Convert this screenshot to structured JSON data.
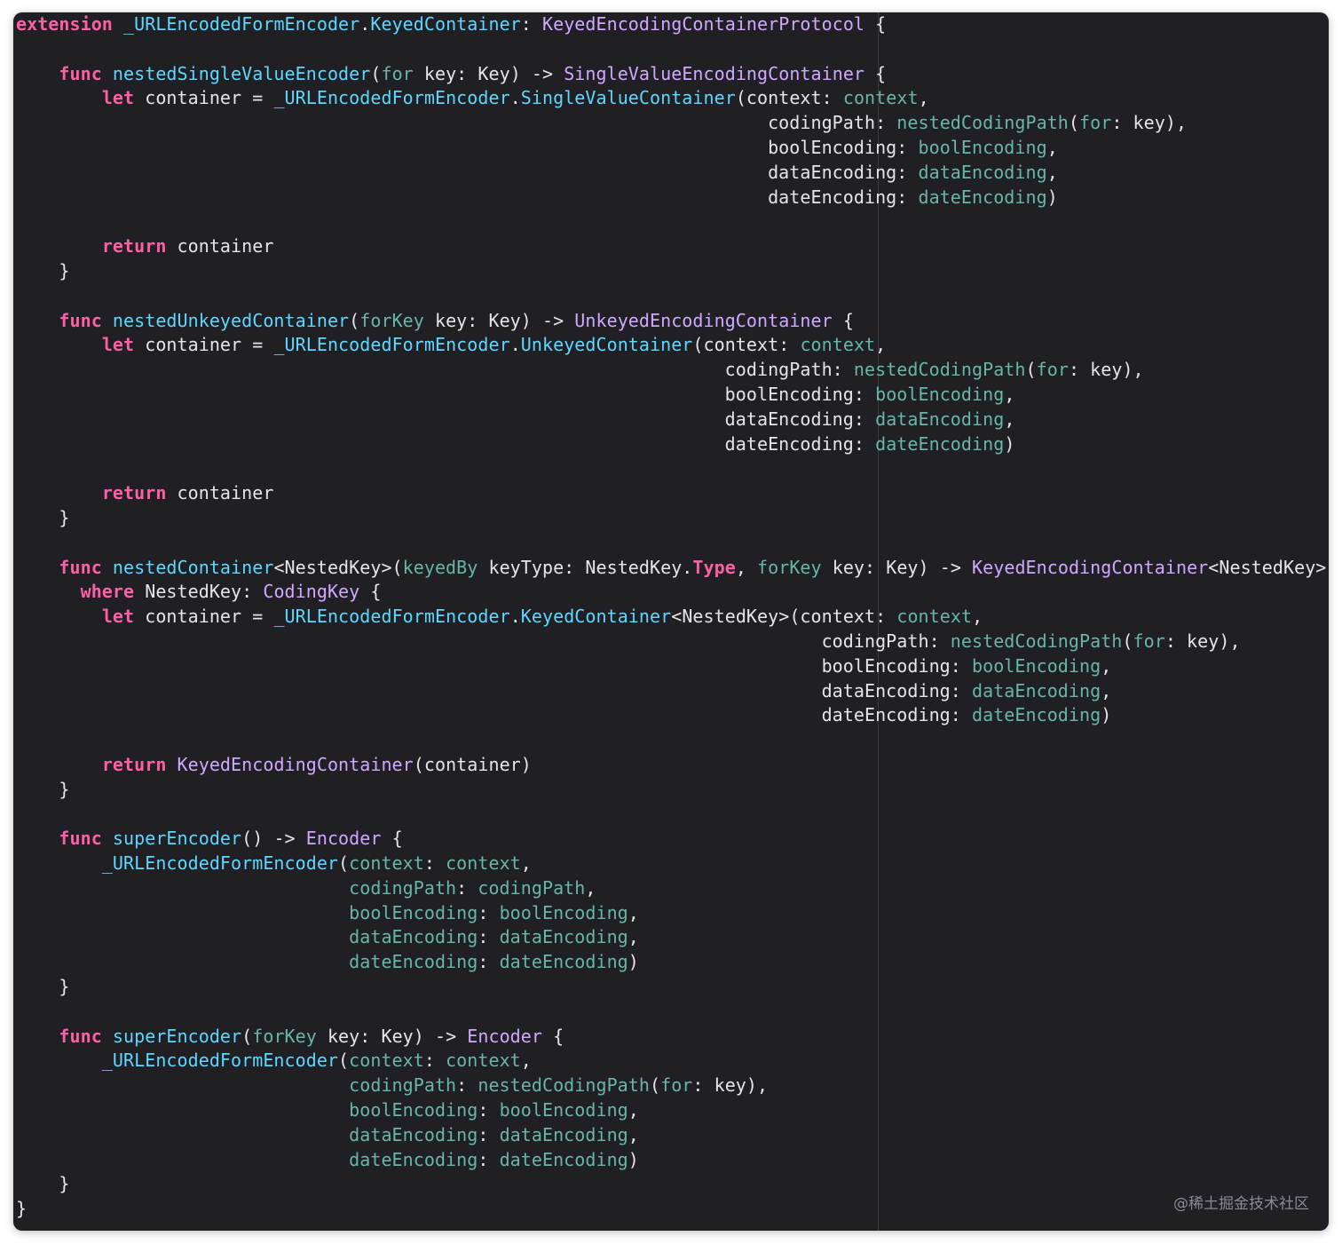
{
  "editor": {
    "theme_colors": {
      "background": "#1f1f24",
      "keyword": "#fc5fa3",
      "function_name": "#67b7a4",
      "type_name": "#d0a8ff",
      "extension_type": "#5dd8ff",
      "plain": "#e6e6e6"
    },
    "lines": [
      [
        [
          "kw",
          "extension"
        ],
        [
          "pl",
          " "
        ],
        [
          "ex",
          "_URLEncodedFormEncoder"
        ],
        [
          "pl",
          "."
        ],
        [
          "ex",
          "KeyedContainer"
        ],
        [
          "pl",
          ": "
        ],
        [
          "ty",
          "KeyedEncodingContainerProtocol"
        ],
        [
          "pl",
          " {"
        ]
      ],
      [],
      [
        [
          "pl",
          "    "
        ],
        [
          "kw",
          "func"
        ],
        [
          "pl",
          " "
        ],
        [
          "ex",
          "nestedSingleValueEncoder"
        ],
        [
          "pl",
          "("
        ],
        [
          "fn",
          "for"
        ],
        [
          "pl",
          " key: Key) -> "
        ],
        [
          "ty",
          "SingleValueEncodingContainer"
        ],
        [
          "pl",
          " {"
        ]
      ],
      [
        [
          "pl",
          "        "
        ],
        [
          "kw",
          "let"
        ],
        [
          "pl",
          " container = "
        ],
        [
          "ex",
          "_URLEncodedFormEncoder"
        ],
        [
          "pl",
          "."
        ],
        [
          "ex",
          "SingleValueContainer"
        ],
        [
          "pl",
          "(context: "
        ],
        [
          "fn",
          "context"
        ],
        [
          "pl",
          ","
        ]
      ],
      [
        [
          "pl",
          "                                                                      codingPath: "
        ],
        [
          "fn",
          "nestedCodingPath"
        ],
        [
          "pl",
          "("
        ],
        [
          "fn",
          "for"
        ],
        [
          "pl",
          ": key),"
        ]
      ],
      [
        [
          "pl",
          "                                                                      boolEncoding: "
        ],
        [
          "fn",
          "boolEncoding"
        ],
        [
          "pl",
          ","
        ]
      ],
      [
        [
          "pl",
          "                                                                      dataEncoding: "
        ],
        [
          "fn",
          "dataEncoding"
        ],
        [
          "pl",
          ","
        ]
      ],
      [
        [
          "pl",
          "                                                                      dateEncoding: "
        ],
        [
          "fn",
          "dateEncoding"
        ],
        [
          "pl",
          ")"
        ]
      ],
      [],
      [
        [
          "pl",
          "        "
        ],
        [
          "kw",
          "return"
        ],
        [
          "pl",
          " container"
        ]
      ],
      [
        [
          "pl",
          "    }"
        ]
      ],
      [],
      [
        [
          "pl",
          "    "
        ],
        [
          "kw",
          "func"
        ],
        [
          "pl",
          " "
        ],
        [
          "ex",
          "nestedUnkeyedContainer"
        ],
        [
          "pl",
          "("
        ],
        [
          "fn",
          "forKey"
        ],
        [
          "pl",
          " key: Key) -> "
        ],
        [
          "ty",
          "UnkeyedEncodingContainer"
        ],
        [
          "pl",
          " {"
        ]
      ],
      [
        [
          "pl",
          "        "
        ],
        [
          "kw",
          "let"
        ],
        [
          "pl",
          " container = "
        ],
        [
          "ex",
          "_URLEncodedFormEncoder"
        ],
        [
          "pl",
          "."
        ],
        [
          "ex",
          "UnkeyedContainer"
        ],
        [
          "pl",
          "(context: "
        ],
        [
          "fn",
          "context"
        ],
        [
          "pl",
          ","
        ]
      ],
      [
        [
          "pl",
          "                                                                  codingPath: "
        ],
        [
          "fn",
          "nestedCodingPath"
        ],
        [
          "pl",
          "("
        ],
        [
          "fn",
          "for"
        ],
        [
          "pl",
          ": key),"
        ]
      ],
      [
        [
          "pl",
          "                                                                  boolEncoding: "
        ],
        [
          "fn",
          "boolEncoding"
        ],
        [
          "pl",
          ","
        ]
      ],
      [
        [
          "pl",
          "                                                                  dataEncoding: "
        ],
        [
          "fn",
          "dataEncoding"
        ],
        [
          "pl",
          ","
        ]
      ],
      [
        [
          "pl",
          "                                                                  dateEncoding: "
        ],
        [
          "fn",
          "dateEncoding"
        ],
        [
          "pl",
          ")"
        ]
      ],
      [],
      [
        [
          "pl",
          "        "
        ],
        [
          "kw",
          "return"
        ],
        [
          "pl",
          " container"
        ]
      ],
      [
        [
          "pl",
          "    }"
        ]
      ],
      [],
      [
        [
          "pl",
          "    "
        ],
        [
          "kw",
          "func"
        ],
        [
          "pl",
          " "
        ],
        [
          "ex",
          "nestedContainer"
        ],
        [
          "pl",
          "<NestedKey>("
        ],
        [
          "fn",
          "keyedBy"
        ],
        [
          "pl",
          " keyType: NestedKey."
        ],
        [
          "kw",
          "Type"
        ],
        [
          "pl",
          ", "
        ],
        [
          "fn",
          "forKey"
        ],
        [
          "pl",
          " key: Key) -> "
        ],
        [
          "ty",
          "KeyedEncodingContainer"
        ],
        [
          "pl",
          "<NestedKey>"
        ]
      ],
      [
        [
          "pl",
          "      "
        ],
        [
          "kw",
          "where"
        ],
        [
          "pl",
          " NestedKey: "
        ],
        [
          "ty",
          "CodingKey"
        ],
        [
          "pl",
          " {"
        ]
      ],
      [
        [
          "pl",
          "        "
        ],
        [
          "kw",
          "let"
        ],
        [
          "pl",
          " container = "
        ],
        [
          "ex",
          "_URLEncodedFormEncoder"
        ],
        [
          "pl",
          "."
        ],
        [
          "ex",
          "KeyedContainer"
        ],
        [
          "pl",
          "<NestedKey>(context: "
        ],
        [
          "fn",
          "context"
        ],
        [
          "pl",
          ","
        ]
      ],
      [
        [
          "pl",
          "                                                                           codingPath: "
        ],
        [
          "fn",
          "nestedCodingPath"
        ],
        [
          "pl",
          "("
        ],
        [
          "fn",
          "for"
        ],
        [
          "pl",
          ": key),"
        ]
      ],
      [
        [
          "pl",
          "                                                                           boolEncoding: "
        ],
        [
          "fn",
          "boolEncoding"
        ],
        [
          "pl",
          ","
        ]
      ],
      [
        [
          "pl",
          "                                                                           dataEncoding: "
        ],
        [
          "fn",
          "dataEncoding"
        ],
        [
          "pl",
          ","
        ]
      ],
      [
        [
          "pl",
          "                                                                           dateEncoding: "
        ],
        [
          "fn",
          "dateEncoding"
        ],
        [
          "pl",
          ")"
        ]
      ],
      [],
      [
        [
          "pl",
          "        "
        ],
        [
          "kw",
          "return"
        ],
        [
          "pl",
          " "
        ],
        [
          "ty",
          "KeyedEncodingContainer"
        ],
        [
          "pl",
          "(container)"
        ]
      ],
      [
        [
          "pl",
          "    }"
        ]
      ],
      [],
      [
        [
          "pl",
          "    "
        ],
        [
          "kw",
          "func"
        ],
        [
          "pl",
          " "
        ],
        [
          "ex",
          "superEncoder"
        ],
        [
          "pl",
          "() -> "
        ],
        [
          "ty",
          "Encoder"
        ],
        [
          "pl",
          " {"
        ]
      ],
      [
        [
          "pl",
          "        "
        ],
        [
          "ex",
          "_URLEncodedFormEncoder"
        ],
        [
          "pl",
          "("
        ],
        [
          "fn",
          "context"
        ],
        [
          "pl",
          ": "
        ],
        [
          "fn",
          "context"
        ],
        [
          "pl",
          ","
        ]
      ],
      [
        [
          "pl",
          "                               "
        ],
        [
          "fn",
          "codingPath"
        ],
        [
          "pl",
          ": "
        ],
        [
          "fn",
          "codingPath"
        ],
        [
          "pl",
          ","
        ]
      ],
      [
        [
          "pl",
          "                               "
        ],
        [
          "fn",
          "boolEncoding"
        ],
        [
          "pl",
          ": "
        ],
        [
          "fn",
          "boolEncoding"
        ],
        [
          "pl",
          ","
        ]
      ],
      [
        [
          "pl",
          "                               "
        ],
        [
          "fn",
          "dataEncoding"
        ],
        [
          "pl",
          ": "
        ],
        [
          "fn",
          "dataEncoding"
        ],
        [
          "pl",
          ","
        ]
      ],
      [
        [
          "pl",
          "                               "
        ],
        [
          "fn",
          "dateEncoding"
        ],
        [
          "pl",
          ": "
        ],
        [
          "fn",
          "dateEncoding"
        ],
        [
          "pl",
          ")"
        ]
      ],
      [
        [
          "pl",
          "    }"
        ]
      ],
      [],
      [
        [
          "pl",
          "    "
        ],
        [
          "kw",
          "func"
        ],
        [
          "pl",
          " "
        ],
        [
          "ex",
          "superEncoder"
        ],
        [
          "pl",
          "("
        ],
        [
          "fn",
          "forKey"
        ],
        [
          "pl",
          " key: Key) -> "
        ],
        [
          "ty",
          "Encoder"
        ],
        [
          "pl",
          " {"
        ]
      ],
      [
        [
          "pl",
          "        "
        ],
        [
          "ex",
          "_URLEncodedFormEncoder"
        ],
        [
          "pl",
          "("
        ],
        [
          "fn",
          "context"
        ],
        [
          "pl",
          ": "
        ],
        [
          "fn",
          "context"
        ],
        [
          "pl",
          ","
        ]
      ],
      [
        [
          "pl",
          "                               "
        ],
        [
          "fn",
          "codingPath"
        ],
        [
          "pl",
          ": "
        ],
        [
          "fn",
          "nestedCodingPath"
        ],
        [
          "pl",
          "("
        ],
        [
          "fn",
          "for"
        ],
        [
          "pl",
          ": key),"
        ]
      ],
      [
        [
          "pl",
          "                               "
        ],
        [
          "fn",
          "boolEncoding"
        ],
        [
          "pl",
          ": "
        ],
        [
          "fn",
          "boolEncoding"
        ],
        [
          "pl",
          ","
        ]
      ],
      [
        [
          "pl",
          "                               "
        ],
        [
          "fn",
          "dataEncoding"
        ],
        [
          "pl",
          ": "
        ],
        [
          "fn",
          "dataEncoding"
        ],
        [
          "pl",
          ","
        ]
      ],
      [
        [
          "pl",
          "                               "
        ],
        [
          "fn",
          "dateEncoding"
        ],
        [
          "pl",
          ": "
        ],
        [
          "fn",
          "dateEncoding"
        ],
        [
          "pl",
          ")"
        ]
      ],
      [
        [
          "pl",
          "    }"
        ]
      ],
      [
        [
          "pl",
          "}"
        ]
      ]
    ]
  },
  "watermark": "@稀土掘金技术社区"
}
